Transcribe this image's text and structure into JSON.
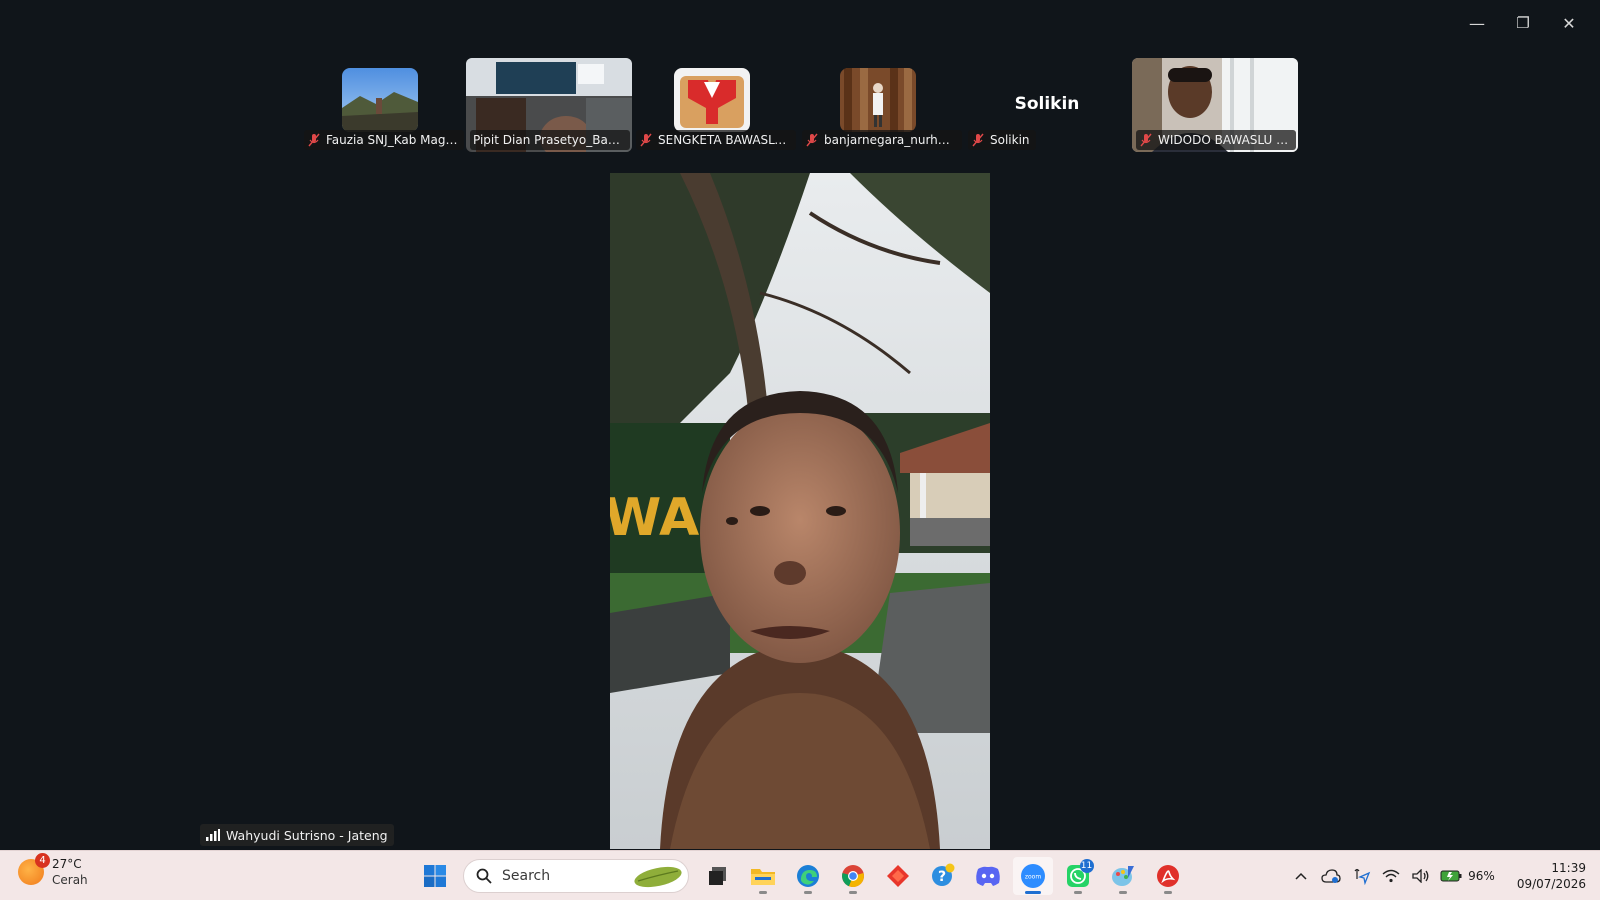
{
  "window": {
    "controls": {
      "minimize": "—",
      "restore": "❐",
      "close": "✕"
    }
  },
  "participants": [
    {
      "name": "Fauzia SNJ_Kab Magel..."
    },
    {
      "name": "Pipit Dian Prasetyo_Bawas..."
    },
    {
      "name": "SENGKETA BAWASLU ..."
    },
    {
      "name": "banjarnegara_nurhasa..."
    },
    {
      "name": "Solikin",
      "avatar_text": "Solikin"
    },
    {
      "name": "WIDODO BAWASLU JA..."
    }
  ],
  "main_video": {
    "speaker": "Wahyudi Sutrisno - Jateng",
    "sign_text": "WAS"
  },
  "taskbar": {
    "weather": {
      "temp": "27°C",
      "condition": "Cerah",
      "badge": "4"
    },
    "search_placeholder": "Search",
    "apps": [
      {
        "name": "start",
        "icon": "windows-logo-icon"
      },
      {
        "name": "task-view",
        "icon": "task-view-icon"
      },
      {
        "name": "file-explorer",
        "icon": "folder-icon"
      },
      {
        "name": "edge",
        "icon": "edge-icon"
      },
      {
        "name": "chrome",
        "icon": "chrome-icon"
      },
      {
        "name": "anydesk",
        "icon": "diamond-icon"
      },
      {
        "name": "help",
        "icon": "help-icon"
      },
      {
        "name": "discord",
        "icon": "discord-icon"
      },
      {
        "name": "zoom",
        "icon": "zoom-icon"
      },
      {
        "name": "whatsapp",
        "icon": "whatsapp-icon",
        "badge": "11"
      },
      {
        "name": "paint",
        "icon": "paint-icon"
      },
      {
        "name": "acrobat",
        "icon": "acrobat-icon"
      }
    ],
    "battery": "96%",
    "time": "11:39",
    "date": "09/07/2026"
  },
  "colors": {
    "background": "#10151a",
    "taskbar": "#f3e7e7",
    "mute_red": "#e04848",
    "accent": "#1f6fd1"
  }
}
